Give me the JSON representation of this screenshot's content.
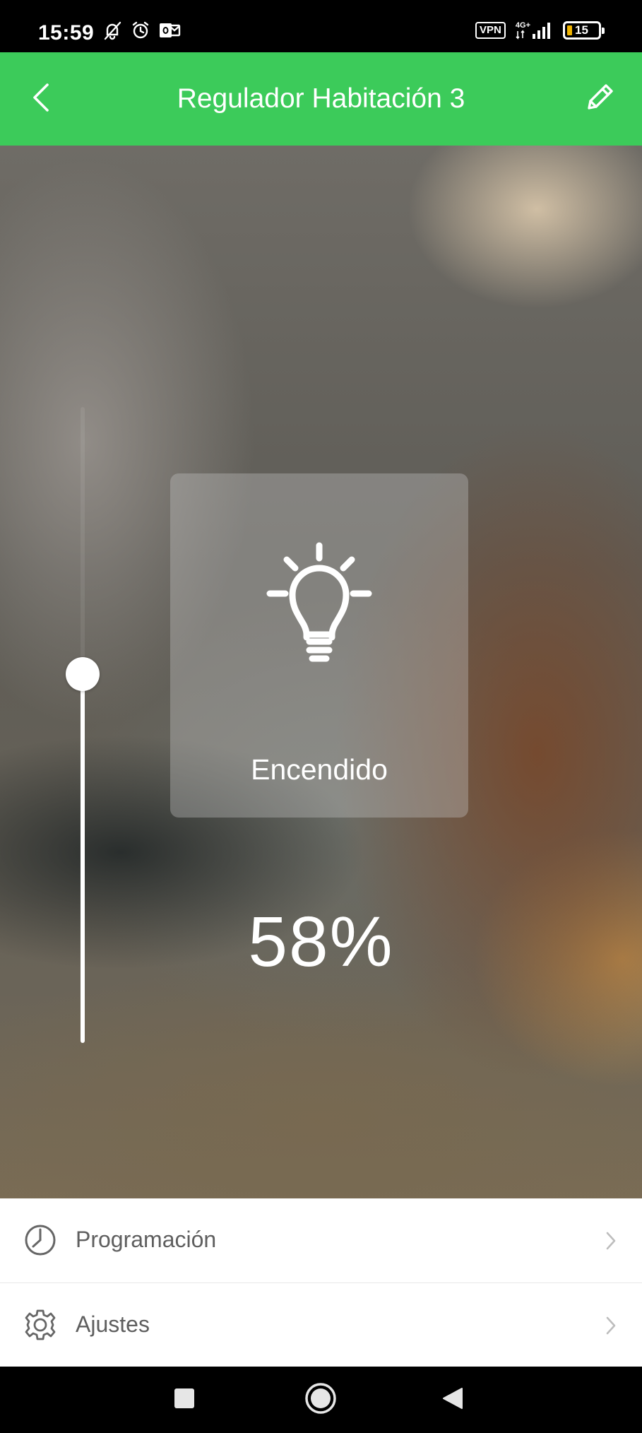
{
  "status_bar": {
    "time": "15:59",
    "vpn_label": "VPN",
    "network_label": "4G+",
    "battery_level": "15"
  },
  "app_bar": {
    "title": "Regulador Habitación 3",
    "icons": {
      "back": "back-chevron-icon",
      "edit": "pencil-icon"
    }
  },
  "dimmer": {
    "state_label": "Encendido",
    "percent_text": "58%",
    "level_fraction": 0.58,
    "bulb_icon": "lightbulb-icon"
  },
  "menu": {
    "items": [
      {
        "label": "Programación",
        "icon": "clock-icon"
      },
      {
        "label": "Ajustes",
        "icon": "gear-icon"
      }
    ]
  },
  "colors": {
    "accent": "#3ccb5a",
    "menu_text": "#5f5f5f"
  }
}
